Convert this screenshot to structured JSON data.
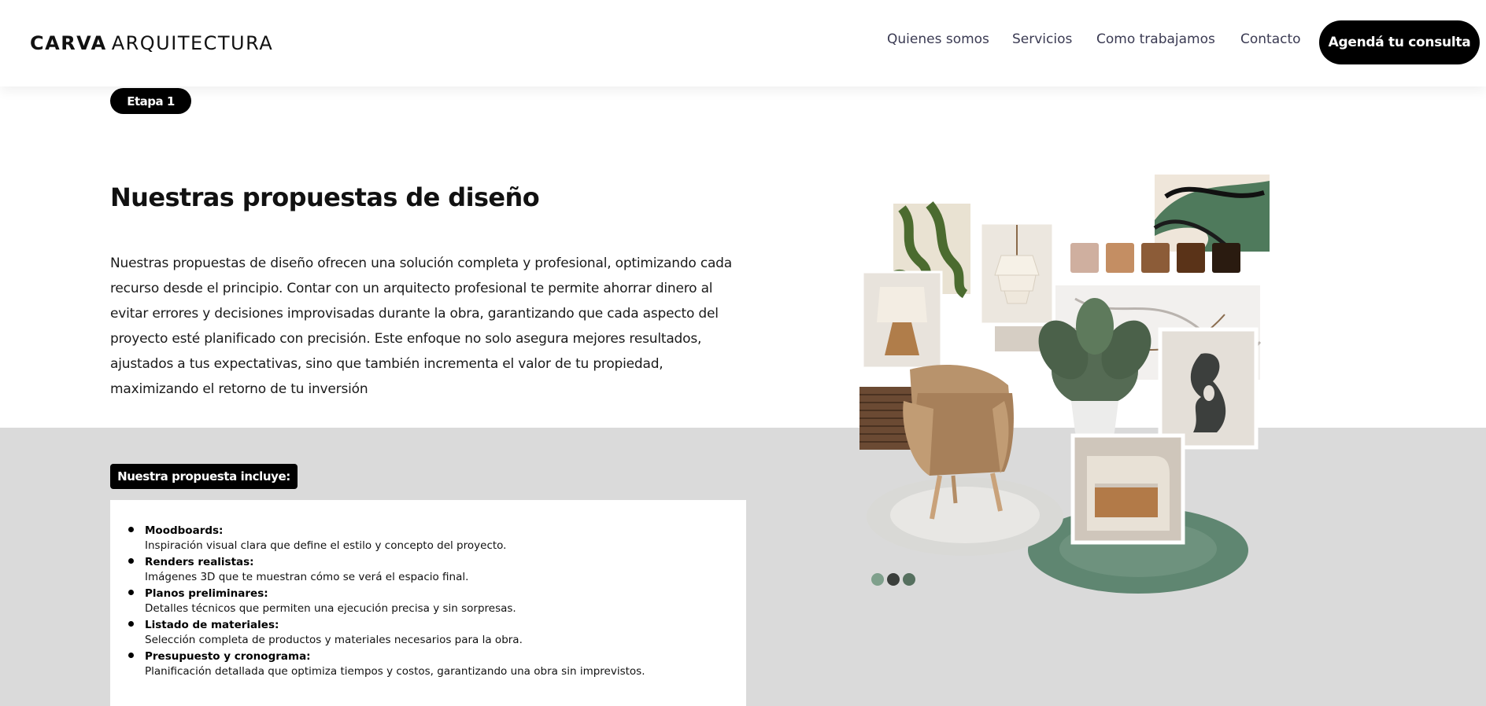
{
  "brand": {
    "bold": "CARVA",
    "regular": "ARQUITECTURA"
  },
  "nav": {
    "items": [
      "Quienes somos",
      "Servicios",
      "Como trabajamos",
      "Contacto"
    ],
    "cta": "Agendá tu consulta"
  },
  "stage": {
    "label": "Etapa 1"
  },
  "section": {
    "title": "Nuestras propuestas de diseño",
    "description": "Nuestras propuestas de diseño ofrecen una solución completa y profesional, optimizando cada recurso desde el principio. Contar con un arquitecto profesional te permite ahorrar dinero al evitar errores y decisiones improvisadas durante la obra, garantizando que cada aspecto del proyecto esté planificado con precisión. Este enfoque no solo asegura mejores resultados, ajustados a tus expectativas, sino que también incrementa el valor de tu propiedad, maximizando el retorno de tu inversión"
  },
  "includes": {
    "label": "Nuestra propuesta incluye:",
    "items": [
      {
        "title": "Moodboards:",
        "desc": "Inspiración visual clara que define el estilo y concepto del proyecto."
      },
      {
        "title": "Renders realistas:",
        "desc": "Imágenes 3D que te muestran cómo se verá el espacio final."
      },
      {
        "title": "Planos preliminares:",
        "desc": "Detalles técnicos que permiten una ejecución precisa y sin sorpresas."
      },
      {
        "title": "Listado de materiales:",
        "desc": "Selección completa de productos y materiales necesarios para la obra."
      },
      {
        "title": "Presupuesto y cronograma:",
        "desc": "Planificación detallada que optimiza tiempos y costos, garantizando una obra sin imprevistos."
      }
    ]
  },
  "colors": {
    "accent": "#000000",
    "band": "#dadada",
    "palette_swatches": [
      "#cfaf9f",
      "#c48e63",
      "#8c5c38",
      "#5a3318",
      "#2a1b10"
    ],
    "carousel_dots": [
      "#7fa08c",
      "#3b3f3c",
      "#56705f"
    ]
  },
  "moodboard": {
    "icons": [
      "abstract-wave-art-icon",
      "pendant-lamp-icon",
      "table-lamp-icon",
      "marble-tile-icon",
      "monstera-plant-icon",
      "armchair-icon",
      "sculpture-icon",
      "nightstand-icon",
      "round-rug-icon",
      "wood-slats-icon"
    ]
  }
}
